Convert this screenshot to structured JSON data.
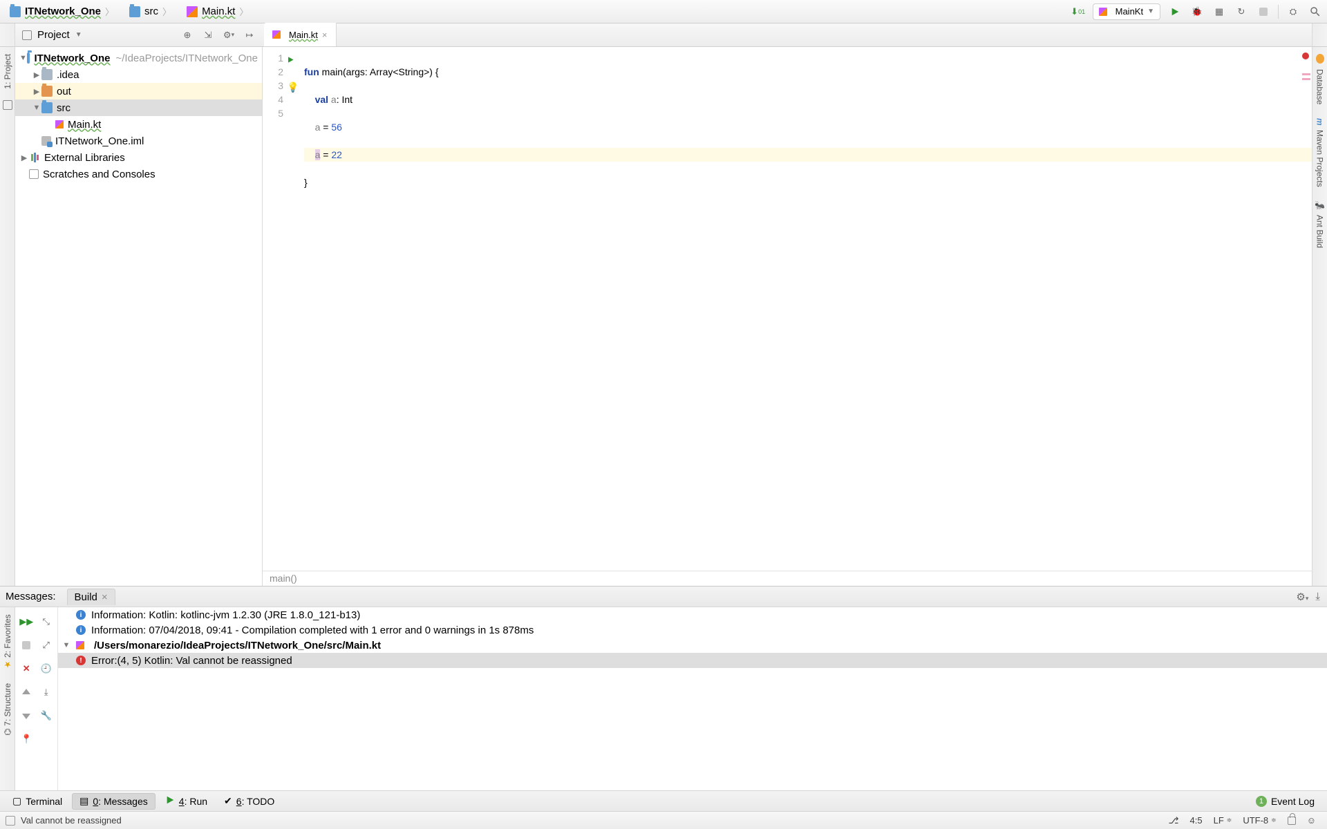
{
  "breadcrumbs": {
    "project": "ITNetwork_One",
    "src": "src",
    "file": "Main.kt"
  },
  "run_config": {
    "name": "MainKt"
  },
  "project_panel": {
    "title": "Project",
    "root_name": "ITNetwork_One",
    "root_path": "~/IdeaProjects/ITNetwork_One",
    "idea": ".idea",
    "out": "out",
    "src": "src",
    "mainkt": "Main.kt",
    "iml": "ITNetwork_One.iml",
    "ext_lib": "External Libraries",
    "scratches": "Scratches and Consoles"
  },
  "editor": {
    "tab": "Main.kt",
    "gutter_run_line": 1,
    "lines": {
      "l1_kw1": "fun",
      "l1_id": "main",
      "l1_args": "(args: Array<String>) {",
      "l2_kw": "val",
      "l2_id": "a",
      "l2_rest": ": Int",
      "l3_id": "a",
      "l3_eq": " = ",
      "l3_num": "56",
      "l4_id": "a",
      "l4_eq": " = ",
      "l4_num": "22",
      "l5": "}"
    },
    "crumb_bar": "main()"
  },
  "messages": {
    "title": "Messages:",
    "tab": "Build",
    "items": {
      "info1": "Information: Kotlin: kotlinc-jvm 1.2.30 (JRE 1.8.0_121-b13)",
      "info2": "Information: 07/04/2018, 09:41 - Compilation completed with 1 error and 0 warnings in 1s 878ms",
      "file": "/Users/monarezio/IdeaProjects/ITNetwork_One/src/Main.kt",
      "err": "Error:(4, 5)  Kotlin: Val cannot be reassigned"
    }
  },
  "bottom": {
    "terminal": "Terminal",
    "messages": "0: Messages",
    "messages_u": "0",
    "run": "4: Run",
    "run_u": "4",
    "todo": "6: TODO",
    "todo_u": "6",
    "eventlog": "Event Log",
    "event_badge": "1"
  },
  "status": {
    "msg": "Val cannot be reassigned",
    "pos": "4:5",
    "le": "LF",
    "enc": "UTF-8"
  },
  "left_tools": {
    "project": "1: Project",
    "favorites": "2: Favorites",
    "structure": "7: Structure"
  },
  "right_tools": {
    "database": "Database",
    "maven": "Maven Projects",
    "ant": "Ant Build"
  }
}
